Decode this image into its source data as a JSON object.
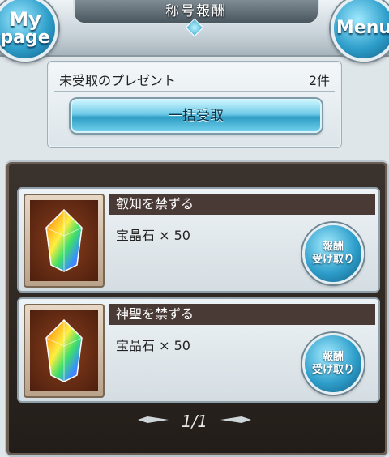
{
  "header": {
    "title": "称号報酬",
    "mypage_line1": "My",
    "mypage_line2": "page",
    "menu_label": "Menu"
  },
  "present": {
    "label": "未受取のプレゼント",
    "count": "2件",
    "bulk_button": "一括受取"
  },
  "rewards": [
    {
      "title": "叡知を禁ずる",
      "item": "宝晶石 × 50",
      "button_line1": "報酬",
      "button_line2": "受け取り",
      "icon": "rainbow-crystal-icon"
    },
    {
      "title": "神聖を禁ずる",
      "item": "宝晶石 × 50",
      "button_line1": "報酬",
      "button_line2": "受け取り",
      "icon": "rainbow-crystal-icon"
    }
  ],
  "pager": {
    "label": "1/1"
  }
}
